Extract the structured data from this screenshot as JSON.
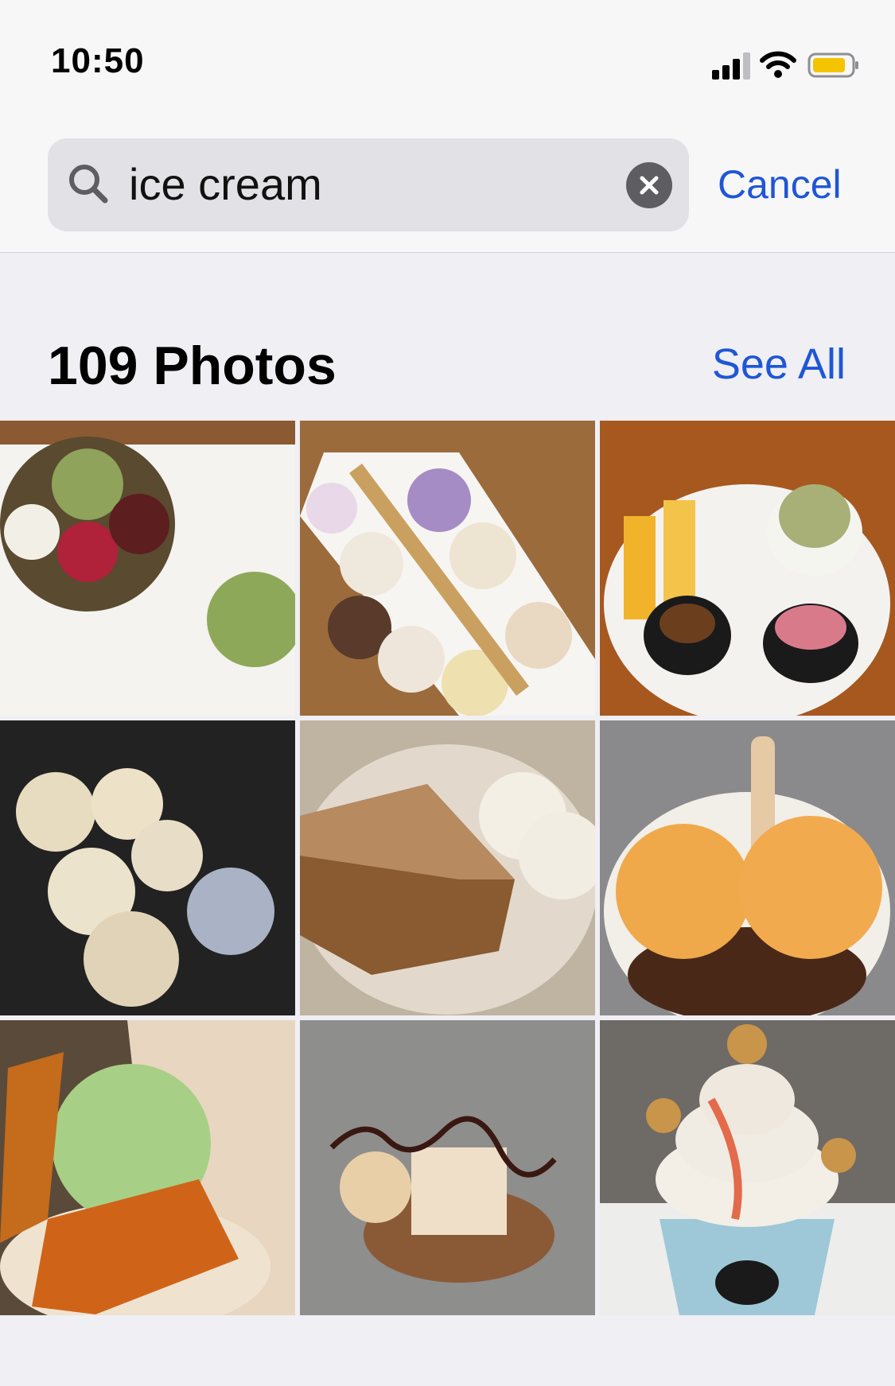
{
  "status_bar": {
    "time": "10:50"
  },
  "search": {
    "query": "ice cream",
    "cancel_label": "Cancel"
  },
  "results": {
    "title": "109 Photos",
    "see_all_label": "See All",
    "photos": [
      "matcha waffle with ice cream",
      "tray of ice cream scoops with wafer",
      "soft serve with mango and desserts",
      "ice cream scoops in clear box",
      "cake with vanilla ice cream",
      "cup of orange ice cream scoops",
      "green ice cream with crisp",
      "plated dessert with ice cream",
      "soft serve cup with bear cookies"
    ]
  },
  "colors": {
    "accent": "#1f56d6",
    "background": "#efeff4"
  }
}
